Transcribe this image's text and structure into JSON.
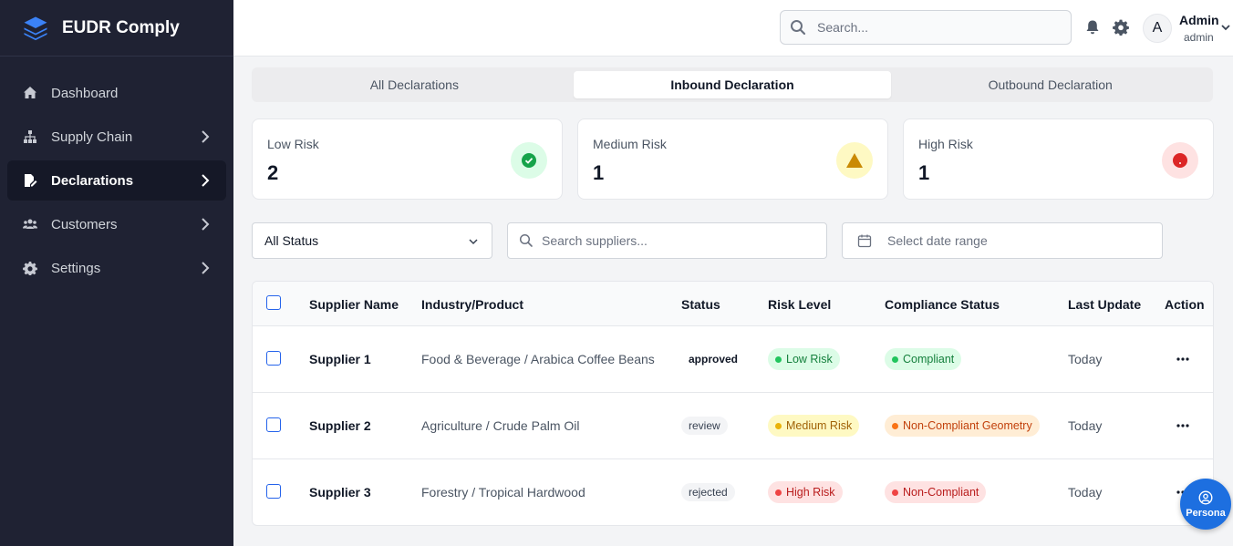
{
  "app": {
    "name": "EUDR Comply",
    "logo_icon": "layers-icon"
  },
  "sidebar": {
    "items": [
      {
        "label": "Dashboard",
        "icon": "home-icon",
        "has_chevron": false,
        "active": false
      },
      {
        "label": "Supply Chain",
        "icon": "sitemap-icon",
        "has_chevron": true,
        "active": false
      },
      {
        "label": "Declarations",
        "icon": "file-signature-icon",
        "has_chevron": true,
        "active": true
      },
      {
        "label": "Customers",
        "icon": "users-icon",
        "has_chevron": true,
        "active": false
      },
      {
        "label": "Settings",
        "icon": "gear-icon",
        "has_chevron": true,
        "active": false
      }
    ]
  },
  "topbar": {
    "search_placeholder": "Search...",
    "user_initial": "A",
    "user_name": "Admin",
    "user_role": "admin"
  },
  "tabs": [
    {
      "label": "All Declarations",
      "active": false
    },
    {
      "label": "Inbound Declaration",
      "active": true
    },
    {
      "label": "Outbound Declaration",
      "active": false
    }
  ],
  "summary": [
    {
      "label": "Low Risk",
      "value": "2",
      "icon": "check-circle-icon",
      "color": "#16a34a",
      "bg": "#dcfce7"
    },
    {
      "label": "Medium Risk",
      "value": "1",
      "icon": "warning-triangle-icon",
      "color": "#ca8a04",
      "bg": "#fef9c3"
    },
    {
      "label": "High Risk",
      "value": "1",
      "icon": "alert-circle-icon",
      "color": "#dc2626",
      "bg": "#fee2e2"
    }
  ],
  "filters": {
    "status_value": "All Status",
    "search_placeholder": "Search suppliers...",
    "date_placeholder": "Select date range"
  },
  "table": {
    "headers": [
      "Supplier Name",
      "Industry/Product",
      "Status",
      "Risk Level",
      "Compliance Status",
      "Last Update",
      "Action"
    ],
    "rows": [
      {
        "name": "Supplier 1",
        "product": "Food & Beverage / Arabica Coffee Beans",
        "status": "approved",
        "risk": "Low Risk",
        "compliance": "Compliant",
        "updated": "Today"
      },
      {
        "name": "Supplier 2",
        "product": "Agriculture / Crude Palm Oil",
        "status": "review",
        "risk": "Medium Risk",
        "compliance": "Non-Compliant Geometry",
        "updated": "Today"
      },
      {
        "name": "Supplier 3",
        "product": "Forestry / Tropical Hardwood",
        "status": "rejected",
        "risk": "High Risk",
        "compliance": "Non-Compliant",
        "updated": "Today"
      }
    ]
  },
  "fab": {
    "label": "Persona",
    "icon": "user-circle-icon"
  },
  "colors": {
    "sidebar_bg": "#1f2233",
    "accent": "#2563eb",
    "low": "#16a34a",
    "medium": "#ca8a04",
    "high": "#dc2626",
    "orange": "#ea580c"
  }
}
